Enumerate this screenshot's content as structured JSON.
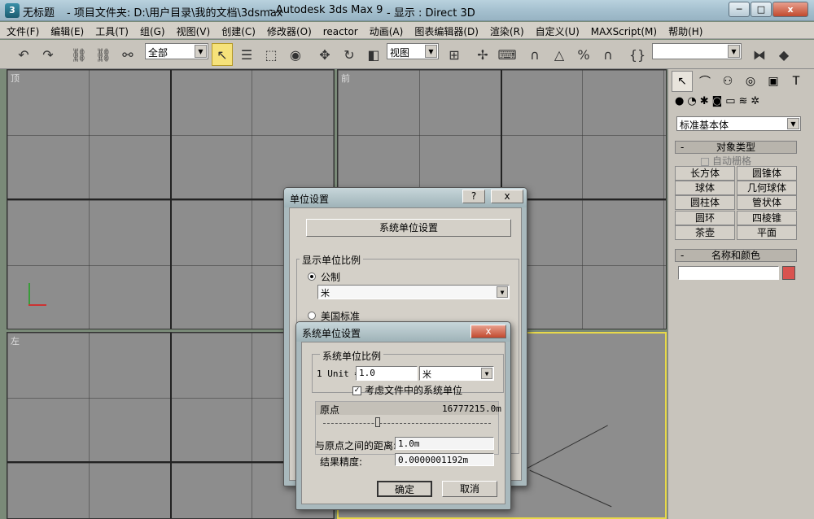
{
  "titlebar": {
    "title": "无标题",
    "project": "- 项目文件夹: D:\\用户目录\\我的文档\\3dsmax",
    "app": "- Autodesk 3ds Max 9",
    "display": "- 显示 : Direct 3D",
    "minimize": "─",
    "maximize": "□",
    "close": "x"
  },
  "menu": [
    "文件(F)",
    "编辑(E)",
    "工具(T)",
    "组(G)",
    "视图(V)",
    "创建(C)",
    "修改器(O)",
    "reactor",
    "动画(A)",
    "图表编辑器(D)",
    "渲染(R)",
    "自定义(U)",
    "MAXScript(M)",
    "帮助(H)"
  ],
  "toolbar": {
    "selection_filter": "全部",
    "ref_coord": "视图",
    "named_sel": ""
  },
  "viewports": {
    "top": "顶",
    "front": "前",
    "left": "左"
  },
  "cmdpanel": {
    "category": "标准基本体",
    "object_type_header": "对象类型",
    "autogrid": "自动栅格",
    "buttons": [
      "长方体",
      "圆锥体",
      "球体",
      "几何球体",
      "圆柱体",
      "管状体",
      "圆环",
      "四棱锥",
      "茶壶",
      "平面"
    ],
    "name_color_header": "名称和颜色",
    "name_value": "",
    "color": "#d9534f",
    "collapse_mark": "-"
  },
  "units_dialog": {
    "title": "单位设置",
    "help": "?",
    "close": "x",
    "system_btn": "系统单位设置",
    "display_group": "显示单位比例",
    "metric": "公制",
    "metric_unit": "米",
    "us": "美国标准"
  },
  "system_dialog": {
    "title": "系统单位设置",
    "close": "x",
    "group": "系统单位比例",
    "unit_prefix": "1 Unit =",
    "unit_value": "1.0",
    "unit_name": "米",
    "consider_files": "考虑文件中的系统单位",
    "origin": "原点",
    "origin_value": "16777215.0m",
    "distance_label": "与原点之间的距离:",
    "distance_value": "1.0m",
    "accuracy_label": "结果精度:",
    "accuracy_value": "0.0000001192m",
    "ok": "确定",
    "cancel": "取消"
  }
}
